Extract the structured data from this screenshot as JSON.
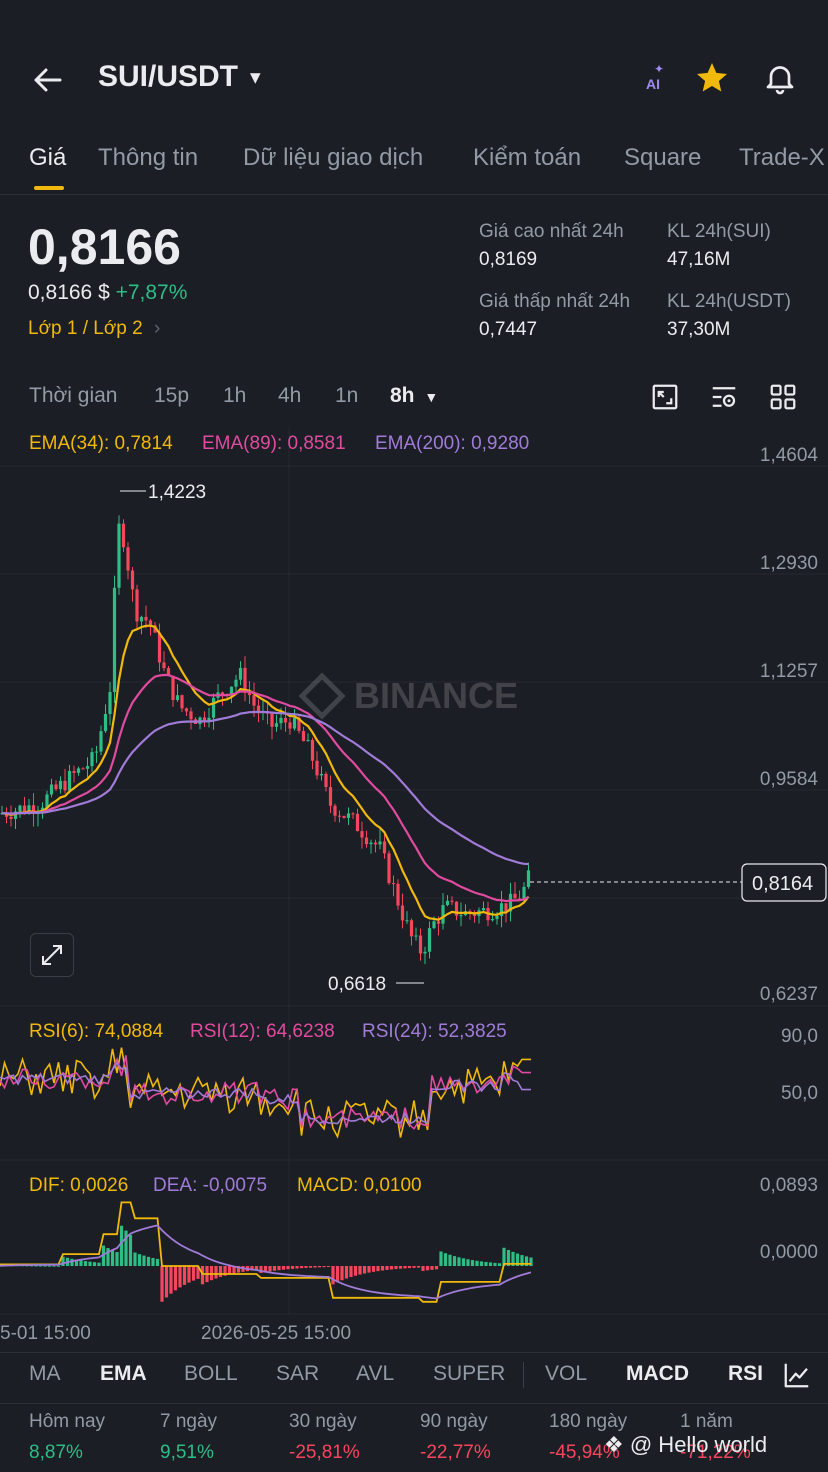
{
  "header": {
    "pair": "SUI/USDT",
    "ai_label": "AI"
  },
  "tabs": [
    {
      "label": "Giá",
      "active": true
    },
    {
      "label": "Thông tin"
    },
    {
      "label": "Dữ liệu giao dịch"
    },
    {
      "label": "Kiểm toán"
    },
    {
      "label": "Square"
    },
    {
      "label": "Trade-X"
    }
  ],
  "price": {
    "last": "0,8166",
    "usd": "0,8166 $",
    "change": "+7,87%",
    "layer": "Lớp 1 / Lớp 2"
  },
  "stats": {
    "high_label": "Giá cao nhất 24h",
    "high_value": "0,8169",
    "low_label": "Giá thấp nhất 24h",
    "low_value": "0,7447",
    "vol_sui_label": "KL 24h(SUI)",
    "vol_sui_value": "47,16M",
    "vol_usdt_label": "KL 24h(USDT)",
    "vol_usdt_value": "37,30M"
  },
  "timeframes": {
    "label": "Thời gian",
    "items": [
      "15p",
      "1h",
      "4h",
      "1n",
      "8h"
    ],
    "active": "8h"
  },
  "indicators": {
    "ema34": "EMA(34): 0,7814",
    "ema89": "EMA(89): 0,8581",
    "ema200": "EMA(200): 0,9280",
    "rsi6": "RSI(6): 74,0884",
    "rsi12": "RSI(12): 64,6238",
    "rsi24": "RSI(24): 52,3825",
    "dif": "DIF: 0,0026",
    "dea": "DEA: -0,0075",
    "macd": "MACD: 0,0100"
  },
  "chart_labels": {
    "price_axis": [
      "1,4604",
      "1,2930",
      "1,1257",
      "0,9584",
      "0,6237"
    ],
    "current_price": "0,8164",
    "high_marker": "1,4223",
    "low_marker": "0,6618",
    "rsi_axis": [
      "90,0",
      "50,0"
    ],
    "macd_axis": [
      "0,0893",
      "0,0000"
    ],
    "time_axis": [
      "5-01 15:00",
      "2026-05-25 15:00"
    ],
    "watermark": "BINANCE"
  },
  "bottom_tabs": [
    {
      "label": "MA"
    },
    {
      "label": "EMA",
      "active": true
    },
    {
      "label": "BOLL"
    },
    {
      "label": "SAR"
    },
    {
      "label": "AVL"
    },
    {
      "label": "SUPER"
    },
    {
      "label": "VOL"
    },
    {
      "label": "MACD",
      "active": true
    },
    {
      "label": "RSI",
      "active": true
    }
  ],
  "performance": [
    {
      "label": "Hôm nay",
      "value": "8,87%",
      "sign": "pos"
    },
    {
      "label": "7 ngày",
      "value": "9,51%",
      "sign": "pos"
    },
    {
      "label": "30 ngày",
      "value": "-25,81%",
      "sign": "neg"
    },
    {
      "label": "90 ngày",
      "value": "-22,77%",
      "sign": "neg"
    },
    {
      "label": "180 ngày",
      "value": "-45,94%",
      "sign": "neg"
    },
    {
      "label": "1 năm",
      "value": "-71,22%",
      "sign": "neg"
    }
  ],
  "overlay_text": "@ Hello world",
  "colors": {
    "up": "#2ebd85",
    "down": "#f6465d",
    "ema34": "#f0b90b",
    "ema89": "#e04ba0",
    "ema200": "#a07bd8",
    "accent": "#f0b90b"
  },
  "chart_data": {
    "type": "candlestick",
    "interval": "8h",
    "ylim": [
      0.6237,
      1.4604
    ],
    "high": 1.4223,
    "low": 0.6618,
    "last": 0.8164,
    "ema_series": [
      {
        "name": "EMA(34)",
        "last": 0.7814
      },
      {
        "name": "EMA(89)",
        "last": 0.8581
      },
      {
        "name": "EMA(200)",
        "last": 0.928
      }
    ],
    "rsi": {
      "ylim": [
        0,
        100
      ],
      "ticks": [
        90,
        50
      ],
      "series": [
        {
          "name": "RSI(6)",
          "last": 74.0884
        },
        {
          "name": "RSI(12)",
          "last": 64.6238
        },
        {
          "name": "RSI(24)",
          "last": 52.3825
        }
      ]
    },
    "macd": {
      "ticks": [
        0.0893,
        0
      ],
      "dif": 0.0026,
      "dea": -0.0075,
      "macd": 0.01
    }
  }
}
